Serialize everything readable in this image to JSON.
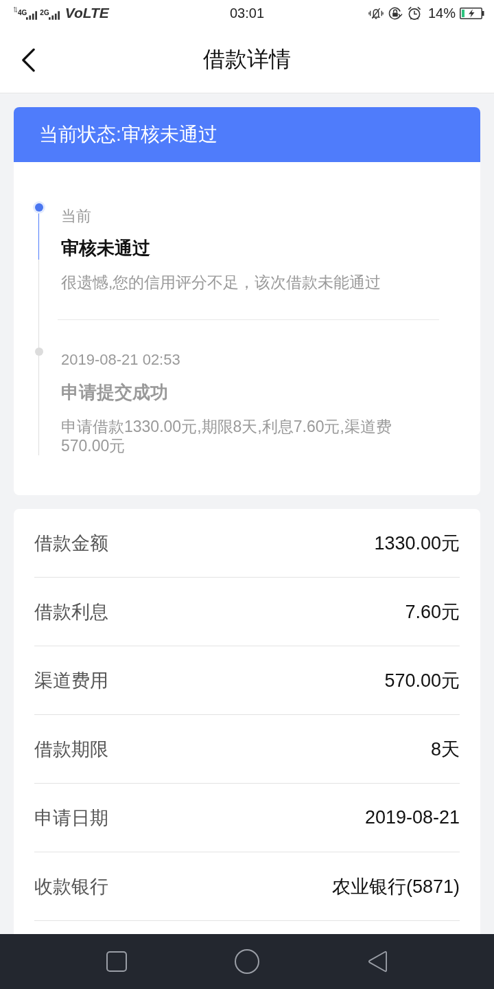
{
  "status_bar": {
    "network_1": "4G",
    "network_2": "2G",
    "volte": "VoLTE",
    "time": "03:01",
    "battery": "14%"
  },
  "header": {
    "title": "借款详情"
  },
  "status_card": {
    "banner": "当前状态:审核未通过",
    "timeline": [
      {
        "current": true,
        "label": "当前",
        "title": "审核未通过",
        "description": "很遗憾,您的信用评分不足，该次借款未能通过"
      },
      {
        "current": false,
        "label": "2019-08-21 02:53",
        "title": "申请提交成功",
        "description": "申请借款1330.00元,期限8天,利息7.60元,渠道费570.00元"
      }
    ]
  },
  "details": [
    {
      "label": "借款金额",
      "value": "1330.00元"
    },
    {
      "label": "借款利息",
      "value": "7.60元"
    },
    {
      "label": "渠道费用",
      "value": "570.00元"
    },
    {
      "label": "借款期限",
      "value": "8天"
    },
    {
      "label": "申请日期",
      "value": "2019-08-21"
    },
    {
      "label": "收款银行",
      "value": "农业银行(5871)"
    }
  ]
}
